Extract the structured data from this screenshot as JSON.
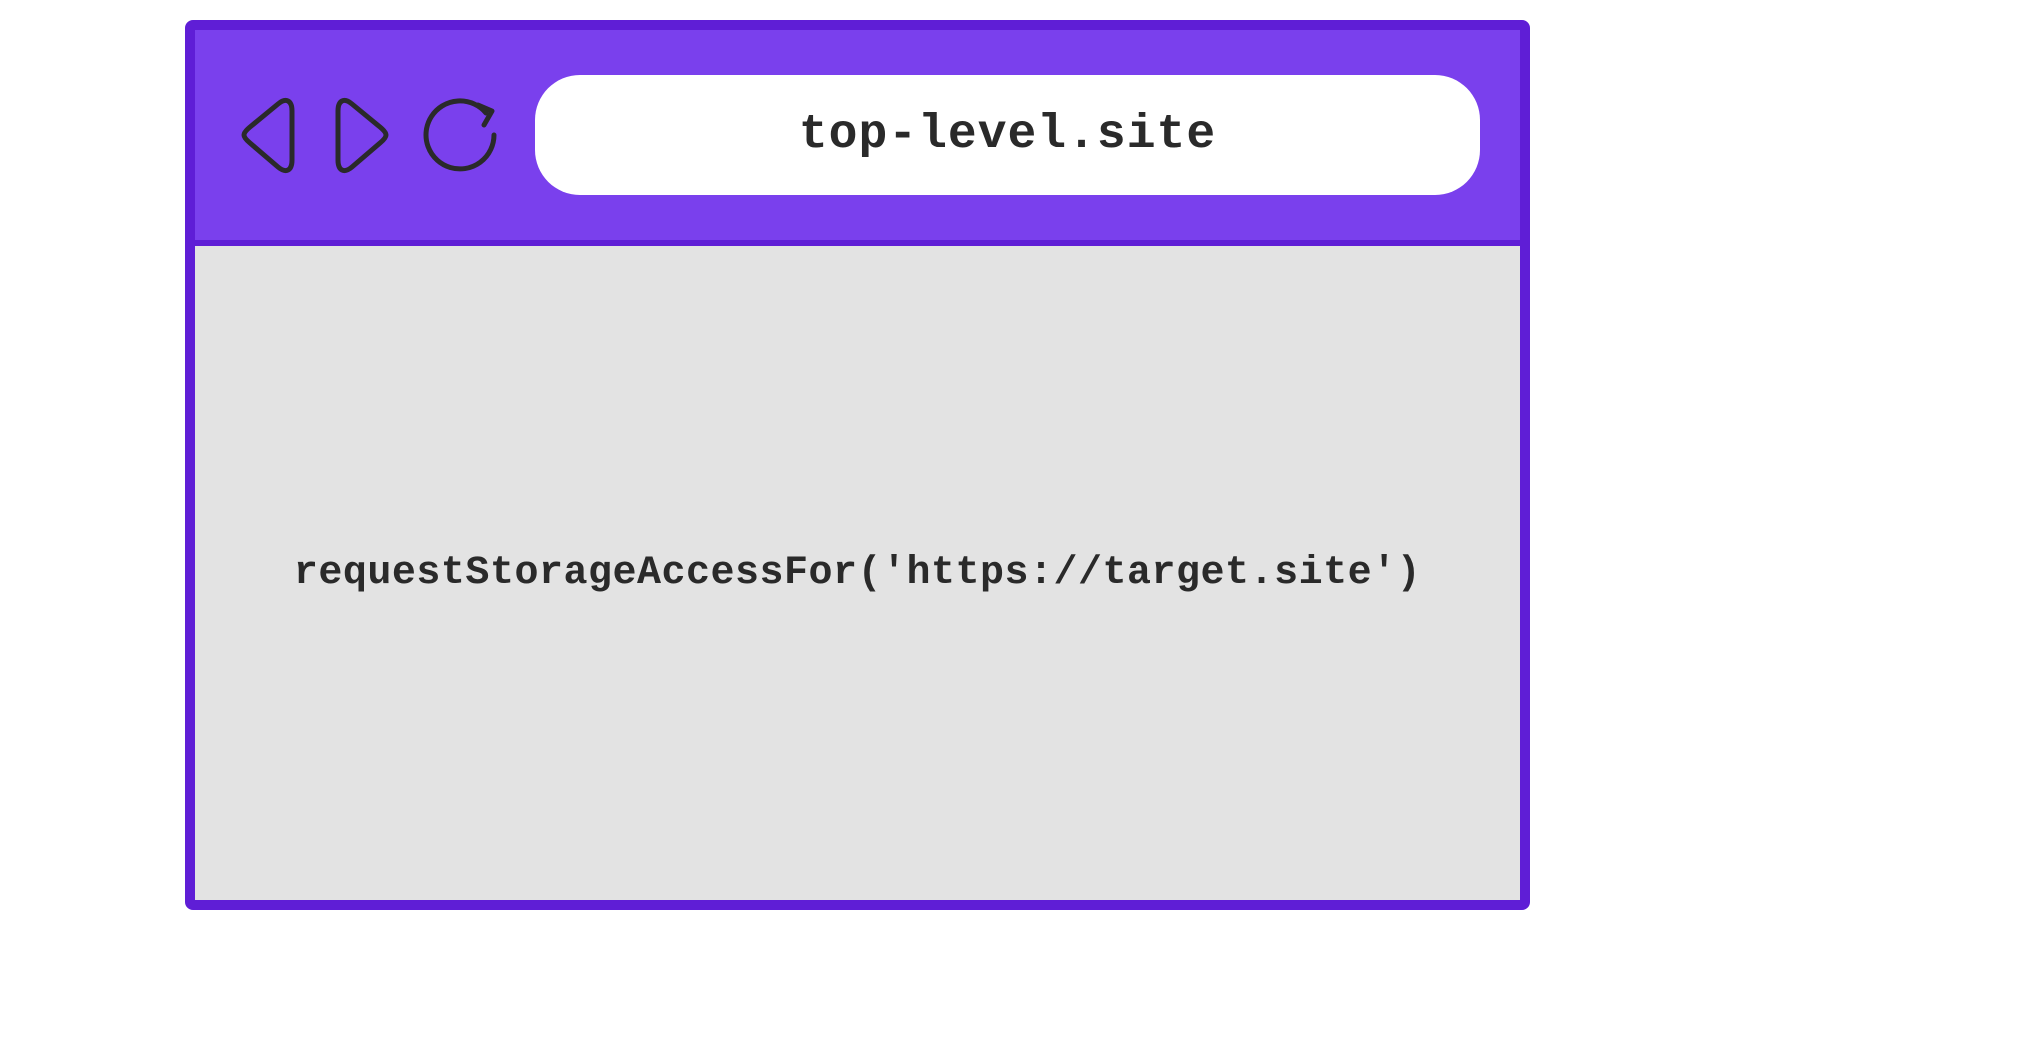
{
  "browser": {
    "address": "top-level.site",
    "content_code": "requestStorageAccessFor('https://target.site')"
  },
  "icons": {
    "back": "back-triangle",
    "forward": "forward-triangle",
    "reload": "reload-arrow"
  },
  "colors": {
    "chrome_bg": "#7a40ed",
    "border": "#5f1ed6",
    "content_bg": "#e3e3e3",
    "text": "#2a2a2a"
  }
}
